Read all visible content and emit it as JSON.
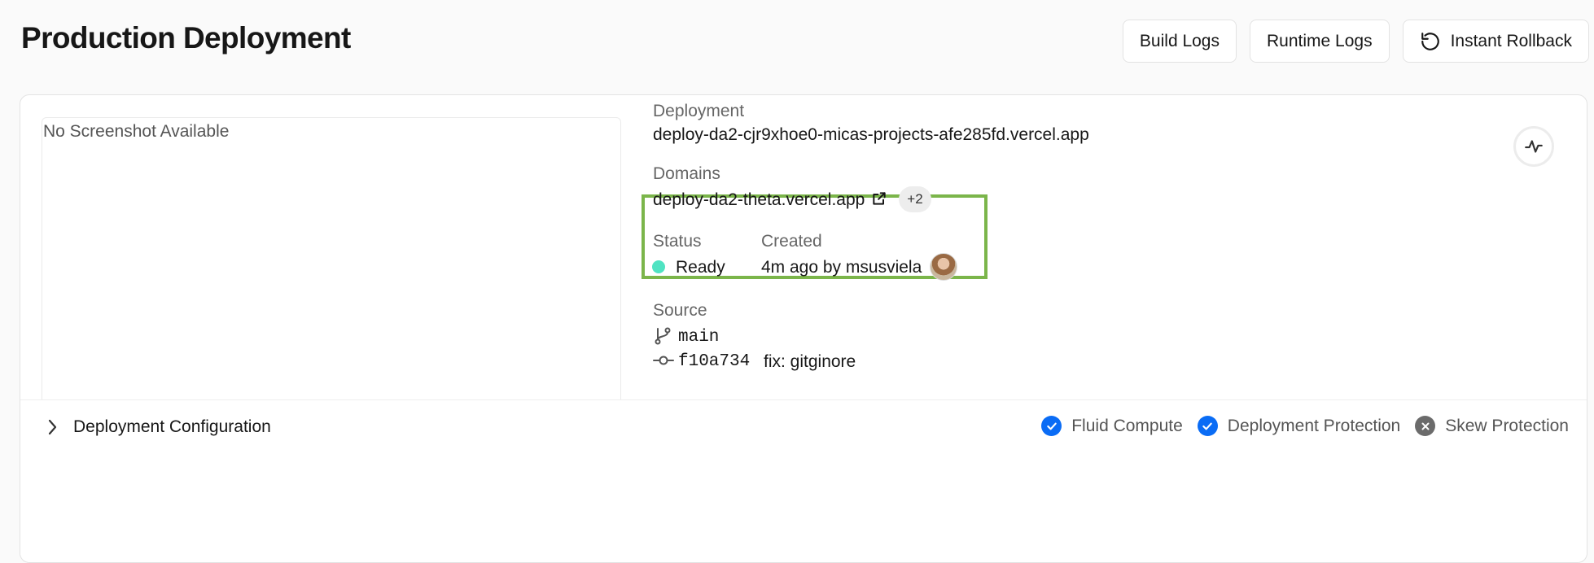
{
  "header": {
    "title": "Production Deployment",
    "actions": [
      {
        "label": "Build Logs"
      },
      {
        "label": "Runtime Logs"
      },
      {
        "label": "Instant Rollback",
        "icon": "rollback-icon"
      }
    ]
  },
  "preview": {
    "placeholder": "No Screenshot Available"
  },
  "details": {
    "deployment_label": "Deployment",
    "deployment_url": "deploy-da2-cjr9xhoe0-micas-projects-afe285fd.vercel.app",
    "domains_label": "Domains",
    "domain": "deploy-da2-theta.vercel.app",
    "extra_domains": "+2",
    "status_label": "Status",
    "status_value": "Ready",
    "status_color": "#50e3c2",
    "created_label": "Created",
    "created_value": "4m ago by msusviela",
    "source_label": "Source",
    "branch": "main",
    "commit_hash": "f10a734",
    "commit_message": "fix: gitginore"
  },
  "footer": {
    "config_label": "Deployment Configuration",
    "features": [
      {
        "label": "Fluid Compute",
        "enabled": true
      },
      {
        "label": "Deployment Protection",
        "enabled": true
      },
      {
        "label": "Skew Protection",
        "enabled": false
      }
    ]
  },
  "colors": {
    "highlight_border": "#7bb54a",
    "enabled_icon": "#0a6cf5",
    "disabled_icon": "#6b6b6b"
  }
}
